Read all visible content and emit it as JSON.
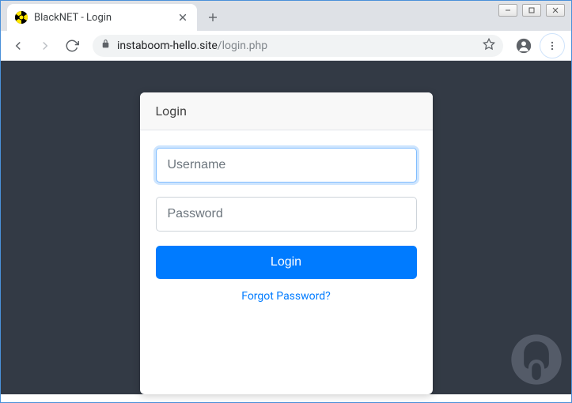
{
  "window": {
    "minimize": "─",
    "maximize": "□",
    "close": "✕"
  },
  "tab": {
    "title": "BlackNET - Login",
    "close": "✕"
  },
  "newtab": "+",
  "toolbar": {
    "url_domain": "instaboom-hello.site",
    "url_path": "/login.php"
  },
  "login": {
    "header": "Login",
    "username_placeholder": "Username",
    "username_value": "",
    "password_placeholder": "Password",
    "password_value": "",
    "button": "Login",
    "forgot": "Forgot Password?"
  }
}
